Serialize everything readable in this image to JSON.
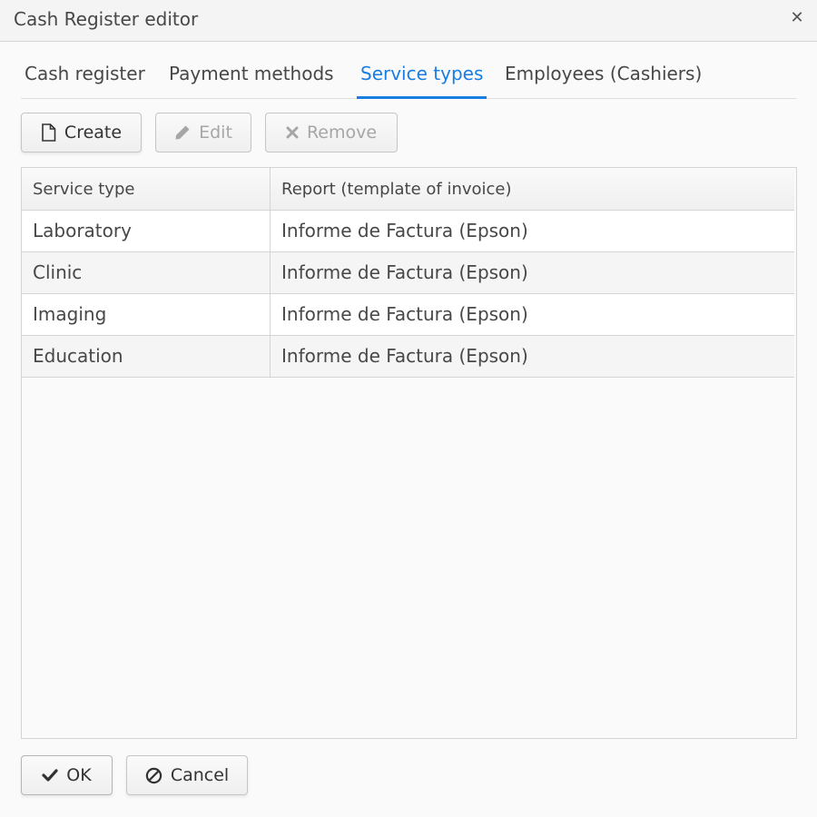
{
  "window": {
    "title": "Cash Register editor",
    "close_icon": "close-icon"
  },
  "tabs": [
    {
      "label": "Cash register",
      "active": false
    },
    {
      "label": "Payment methods",
      "active": false
    },
    {
      "label": "Service types",
      "active": true
    },
    {
      "label": "Employees (Cashiers)",
      "active": false
    }
  ],
  "toolbar": {
    "create_label": "Create",
    "create_icon": "document-icon",
    "edit_label": "Edit",
    "edit_icon": "pencil-icon",
    "remove_label": "Remove",
    "remove_icon": "x-icon"
  },
  "grid": {
    "columns": [
      "Service type",
      "Report (template of invoice)"
    ],
    "rows": [
      [
        "Laboratory",
        "Informe de Factura (Epson)"
      ],
      [
        "Clinic",
        "Informe de Factura (Epson)"
      ],
      [
        "Imaging",
        "Informe de Factura (Epson)"
      ],
      [
        "Education",
        "Informe de Factura (Epson)"
      ]
    ]
  },
  "footer": {
    "ok_label": "OK",
    "ok_icon": "check-icon",
    "cancel_label": "Cancel",
    "cancel_icon": "ban-icon"
  },
  "colors": {
    "accent": "#197de1",
    "text": "#474747",
    "disabled_text": "#a6a6a6",
    "border": "#d4d4d4"
  }
}
